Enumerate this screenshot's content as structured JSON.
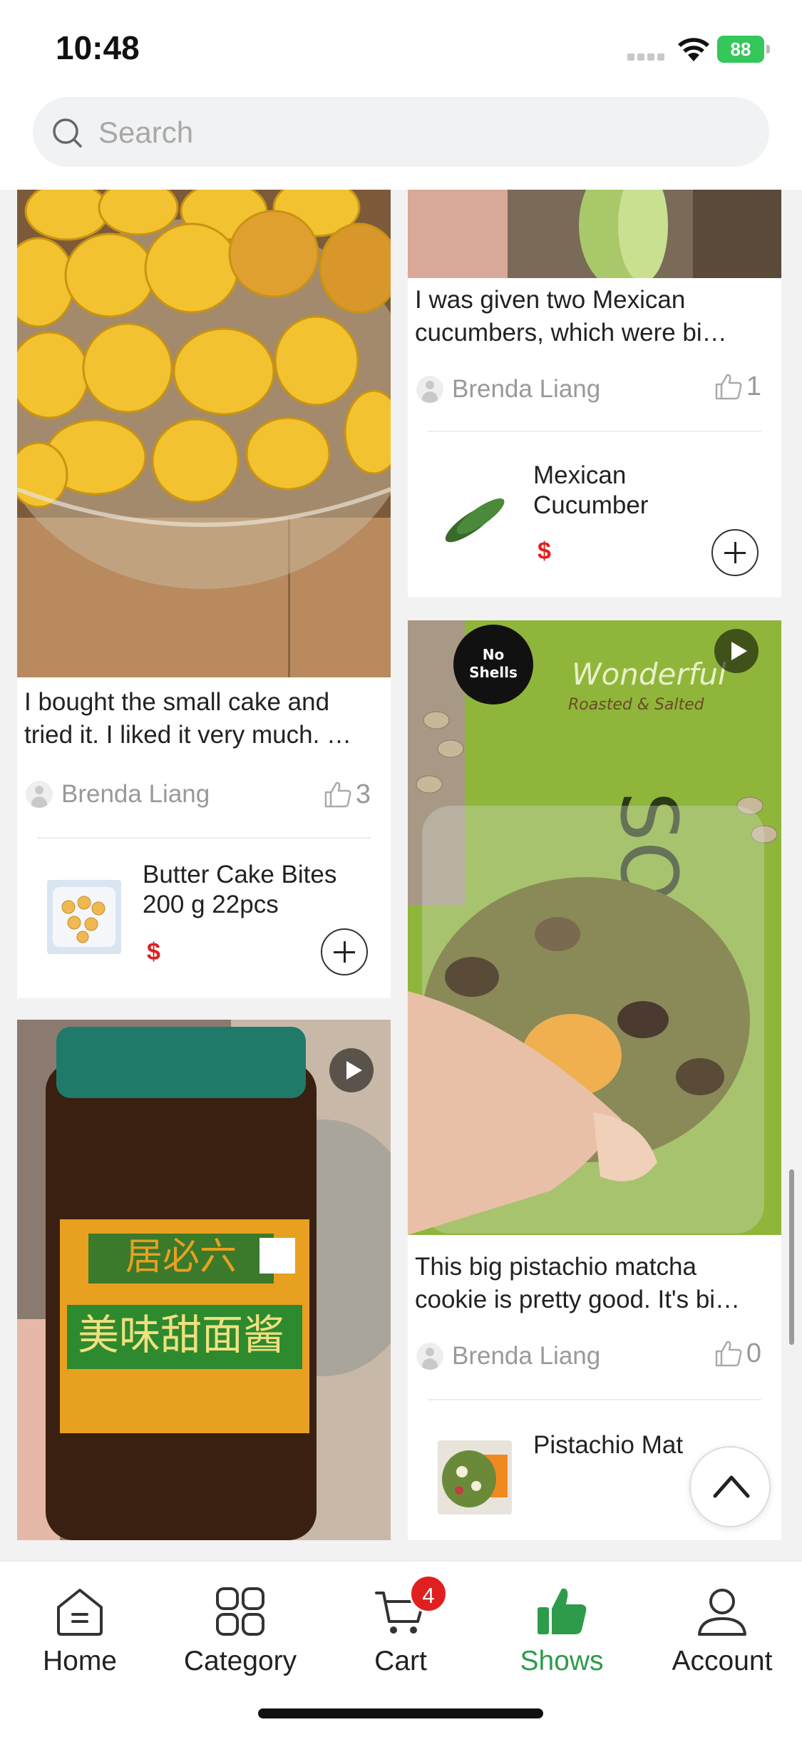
{
  "status_bar": {
    "time": "10:48",
    "battery": "88"
  },
  "search": {
    "placeholder": "Search"
  },
  "feed": {
    "left": [
      {
        "caption_lines": [
          "I bought the small cake and",
          "tried it. I liked it very much. …"
        ],
        "author": "Brenda Liang",
        "likes": "3",
        "product": {
          "name_lines": [
            "Butter Cake Bites",
            "200 g 22pcs"
          ],
          "price": "$"
        }
      },
      {
        "has_video": true
      }
    ],
    "right": [
      {
        "caption_lines": [
          "I was given two Mexican",
          "cucumbers, which were bi…"
        ],
        "author": "Brenda Liang",
        "likes": "1",
        "product": {
          "name_lines": [
            "Mexican",
            "Cucumber"
          ],
          "price": "$"
        }
      },
      {
        "has_video": true,
        "caption_lines": [
          "This big pistachio matcha",
          "cookie is pretty good. It's bi…"
        ],
        "author": "Brenda Liang",
        "likes": "0",
        "product": {
          "name_lines": [
            "Pistachio Mat"
          ]
        }
      }
    ]
  },
  "tab_bar": {
    "items": [
      {
        "label": "Home",
        "icon": "home-icon"
      },
      {
        "label": "Category",
        "icon": "category-icon"
      },
      {
        "label": "Cart",
        "icon": "cart-icon",
        "badge": "4"
      },
      {
        "label": "Shows",
        "icon": "thumbs-up-icon",
        "active": true
      },
      {
        "label": "Account",
        "icon": "account-icon"
      }
    ]
  },
  "colors": {
    "accent": "#2e9b4b",
    "price": "#e02020",
    "badge": "#e02020"
  }
}
